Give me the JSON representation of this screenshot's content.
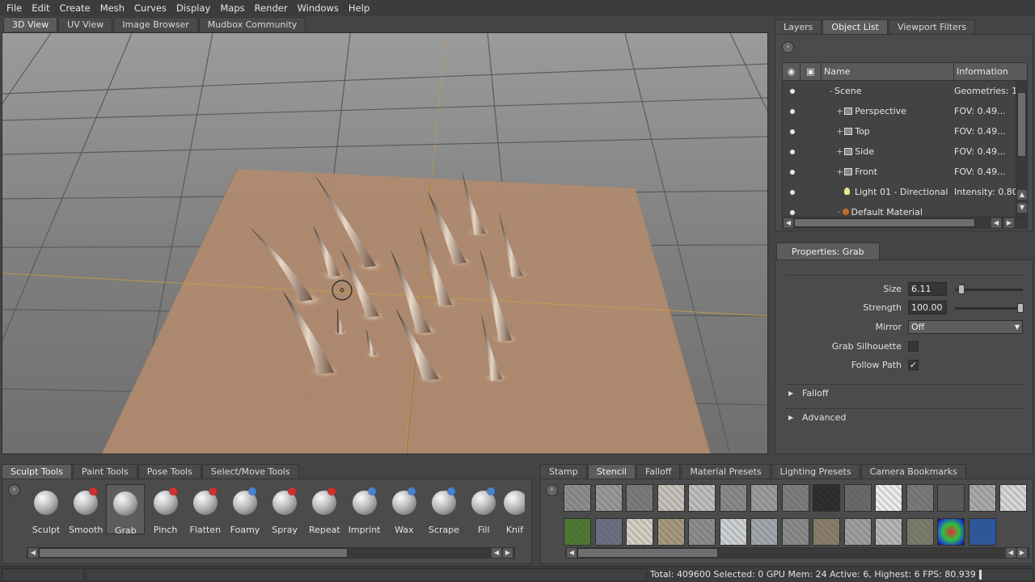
{
  "menu": [
    "File",
    "Edit",
    "Create",
    "Mesh",
    "Curves",
    "Display",
    "Maps",
    "Render",
    "Windows",
    "Help"
  ],
  "view_tabs": [
    "3D View",
    "UV View",
    "Image Browser",
    "Mudbox Community"
  ],
  "right_tabs": [
    "Layers",
    "Object List",
    "Viewport Filters"
  ],
  "object_list": {
    "columns": {
      "name": "Name",
      "info": "Information"
    },
    "rows": [
      {
        "name": "Scene",
        "info": "Geometries: 1..."
      },
      {
        "name": "Perspective",
        "info": "FOV: 0.49..."
      },
      {
        "name": "Top",
        "info": "FOV: 0.49..."
      },
      {
        "name": "Side",
        "info": "FOV: 0.49..."
      },
      {
        "name": "Front",
        "info": "FOV: 0.49..."
      },
      {
        "name": "Light 01 - Directional",
        "info": "Intensity: 0.80"
      },
      {
        "name": "Default Material",
        "info": ""
      }
    ]
  },
  "properties": {
    "tab": "Properties: Grab",
    "size_label": "Size",
    "size_value": "6.11",
    "strength_label": "Strength",
    "strength_value": "100.00",
    "mirror_label": "Mirror",
    "mirror_value": "Off",
    "grab_silhouette_label": "Grab Silhouette",
    "follow_path_label": "Follow Path",
    "follow_path_check": "✓",
    "falloff_label": "Falloff",
    "advanced_label": "Advanced"
  },
  "tool_tabs": [
    "Sculpt Tools",
    "Paint Tools",
    "Pose Tools",
    "Select/Move Tools"
  ],
  "tools": [
    "Sculpt",
    "Smooth",
    "Grab",
    "Pinch",
    "Flatten",
    "Foamy",
    "Spray",
    "Repeat",
    "Imprint",
    "Wax",
    "Scrape",
    "Fill",
    "Knif"
  ],
  "active_tool": "Grab",
  "stamp_tabs": [
    "Stamp",
    "Stencil",
    "Falloff",
    "Material Presets",
    "Lighting Presets",
    "Camera Bookmarks"
  ],
  "active_stamp_tab": "Stencil",
  "status": "Total: 409600  Selected: 0 GPU Mem: 24  Active: 6, Highest: 6  FPS: 80.9397",
  "colors": {
    "plane": "#b08a6e",
    "grid": "#5a5a5a",
    "axis": "#c8a040"
  }
}
